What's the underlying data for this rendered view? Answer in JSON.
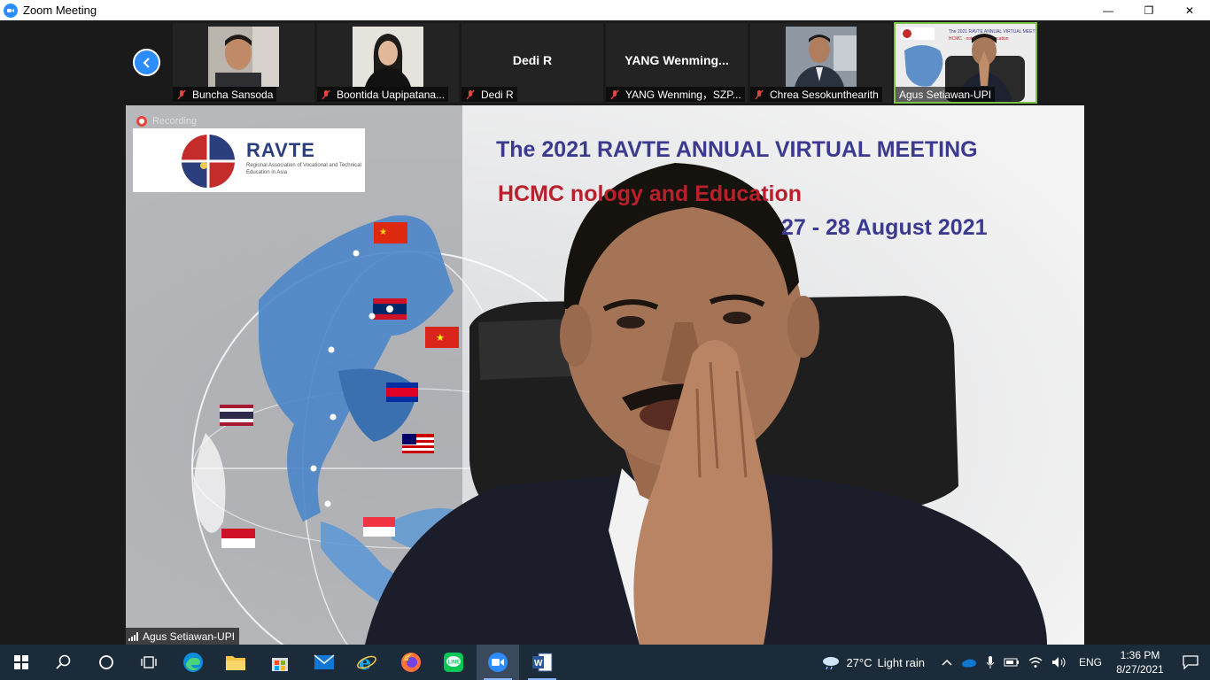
{
  "window": {
    "title": "Zoom Meeting",
    "minimize": "—",
    "restore": "❐",
    "close": "✕"
  },
  "gallery": {
    "participants": [
      {
        "name": "Buncha Sansoda",
        "muted": true,
        "video": true
      },
      {
        "name": "Boontida Uapipatana...",
        "muted": true,
        "video": true
      },
      {
        "name": "Dedi R",
        "display": "Dedi R",
        "muted": true,
        "video": false
      },
      {
        "name": "YANG Wenming，SZP...",
        "display": "YANG Wenming...",
        "muted": true,
        "video": false
      },
      {
        "name": "Chrea Sesokunthearith",
        "muted": true,
        "video": true
      },
      {
        "name": "Agus Setiawan-UPI",
        "muted": false,
        "video": true,
        "active": true
      }
    ]
  },
  "main": {
    "recording_label": "Recording",
    "speaker_name": "Agus Setiawan-UPI",
    "slide": {
      "logo_title": "RAVTE",
      "logo_subtitle": "Regional Association of Vocational and Technical Education in Asia",
      "line1": "The 2021 RAVTE ANNUAL VIRTUAL MEETING",
      "line2": "HCMC        nology and Education",
      "line3": "27 - 28 August 2021"
    }
  },
  "taskbar": {
    "apps": [
      "start-icon",
      "search-icon",
      "cortana-icon",
      "task-view-icon",
      "edge-icon",
      "file-explorer-icon",
      "store-icon",
      "mail-icon",
      "ie-icon",
      "firefox-icon",
      "line-icon",
      "zoom-icon",
      "word-icon"
    ],
    "weather_temp": "27°C",
    "weather_text": "Light rain",
    "language": "ENG",
    "time": "1:36 PM",
    "date": "8/27/2021"
  },
  "colors": {
    "zoom_blue": "#2D8CFF",
    "active_border": "#7bc142",
    "muted_red": "#e0463e",
    "taskbar": "#1c2b3a"
  }
}
